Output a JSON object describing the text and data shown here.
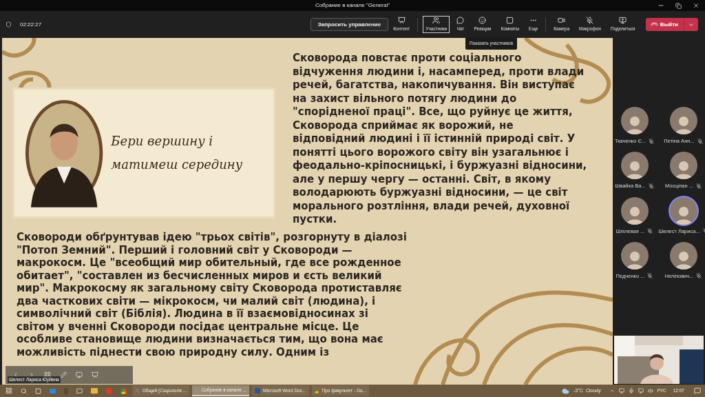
{
  "window": {
    "title": "Собрание в канале \"General\""
  },
  "toolbar": {
    "timer": "02:22:27",
    "request_control": "Запросить управление",
    "buttons": [
      {
        "kind": "content",
        "label": "Контент",
        "selected": false
      },
      {
        "kind": "people",
        "label": "Участники",
        "selected": true
      },
      {
        "kind": "chat",
        "label": "Чат",
        "selected": false
      },
      {
        "kind": "reactions",
        "label": "Реакции",
        "selected": false
      },
      {
        "kind": "rooms",
        "label": "Комнаты",
        "selected": false
      },
      {
        "kind": "more",
        "label": "Еще",
        "selected": false
      },
      {
        "kind": "camera",
        "label": "Камера",
        "selected": false
      },
      {
        "kind": "mic",
        "label": "Микрофон",
        "selected": false
      },
      {
        "kind": "share",
        "label": "Поделиться",
        "selected": false
      }
    ],
    "leave": "Выйти",
    "tooltip": "Показать участников"
  },
  "slide": {
    "motto": "Бери вершину і матимеш середину",
    "paragraph_1": [
      "Сковорода повстає проти соціального",
      "відчуження людини і, насамперед, проти влади",
      "речей, багатства, накопичування. Він виступає",
      "на захист вільного потягу людини до",
      "\"спорідненої праці\". Все, що руйнує це життя,",
      "Сковорода сприймає як ворожий, не",
      "відповідний людині і її істинній природі світ. У",
      "понятті цього ворожого світу він узагальнює і",
      "феодально-кріпосницькі, і буржуазні відносини,",
      "але у першу чергу — останні. Світ, в якому",
      "володарюють буржуазні відносини, — це світ",
      "морального розтління, влади речей, духовної",
      "пустки."
    ],
    "paragraph_2": [
      "Сковороди обґрунтував ідею \"трьох світів\", розгорнуту в діалозі",
      "\"Потоп Земний\". Перший і головний світ у Сковороди —",
      "макрокосм. Це \"всеобщий мир обительный, где все рожденное",
      "обитает\", \"составлен из бесчисленных миров и єсть великий",
      "мир\". Макрокосму як загальному світу Сковорода протиставляє",
      "два часткових світи — мікрокосм, чи малий світ (людина), і",
      "символічний світ (Біблія). Людина в її взаємовідносинах зі",
      "світом у вченні Сковороди посідає центральне місце. Це",
      "особливе становище людини визначається тим, що вона має",
      "можливість піднести свою природну силу. Одним із"
    ]
  },
  "presenter": {
    "name": "Шелест Лариса Юріївна"
  },
  "participants": [
    {
      "name": "Ткаченко Є...",
      "speaking": false
    },
    {
      "name": "Петіна Анн...",
      "speaking": false
    },
    {
      "name": "Швайка Ва...",
      "speaking": false
    },
    {
      "name": "Мосціпан ...",
      "speaking": false
    },
    {
      "name": "Шпілєвая ...",
      "speaking": false
    },
    {
      "name": "Шелест Лариса...",
      "speaking": true
    },
    {
      "name": "Педченко ...",
      "speaking": false
    },
    {
      "name": "Неліпович...",
      "speaking": false
    }
  ],
  "taskbar": {
    "windows": [
      {
        "label": "Общий (Соціологія ...",
        "selected": false,
        "kind": "teams"
      },
      {
        "label": "Собрание в канале ...",
        "selected": true,
        "kind": "teams"
      },
      {
        "label": "Microsoft Word Doc...",
        "selected": false,
        "kind": "word"
      },
      {
        "label": "Про факультет - Go...",
        "selected": false,
        "kind": "chrome"
      }
    ],
    "weather": "-3°C  Cloudy",
    "language": "РУС",
    "clock": "12:07"
  }
}
